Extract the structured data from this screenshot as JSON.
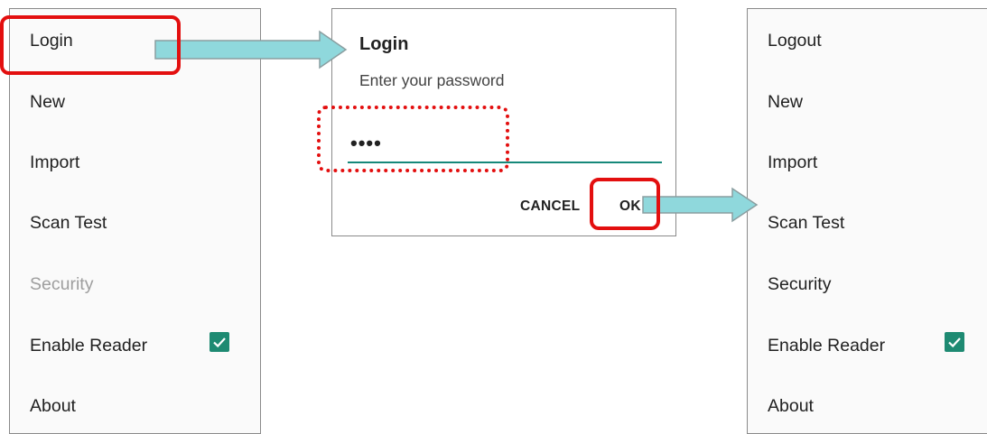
{
  "left_menu": {
    "items": [
      {
        "label": "Login"
      },
      {
        "label": "New"
      },
      {
        "label": "Import"
      },
      {
        "label": "Scan Test"
      },
      {
        "label": "Security",
        "disabled": true
      },
      {
        "label": "Enable Reader",
        "checked": true
      },
      {
        "label": "About"
      }
    ]
  },
  "dialog": {
    "title": "Login",
    "message": "Enter your password",
    "password_value": "••••",
    "cancel_label": "CANCEL",
    "ok_label": "OK"
  },
  "right_menu": {
    "items": [
      {
        "label": "Logout"
      },
      {
        "label": "New"
      },
      {
        "label": "Import"
      },
      {
        "label": "Scan Test"
      },
      {
        "label": "Security"
      },
      {
        "label": "Enable Reader",
        "checked": true
      },
      {
        "label": "About"
      }
    ]
  },
  "colors": {
    "accent": "#1e8a72",
    "highlight": "#e30f0f",
    "arrow_fill": "#8fd8dc"
  }
}
